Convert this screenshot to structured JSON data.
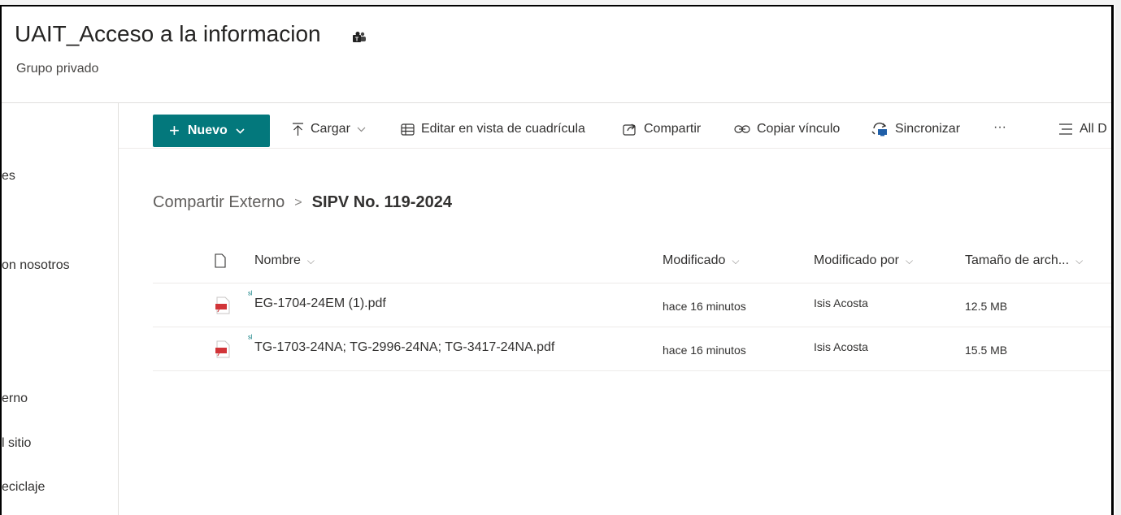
{
  "site": {
    "title": "UAIT_Acceso a la informacion",
    "subtitle": "Grupo privado",
    "teams_icon": "teams-icon"
  },
  "left_nav": {
    "items": [
      {
        "label": "es"
      },
      {
        "label": "on nosotros"
      },
      {
        "label": "erno"
      },
      {
        "label": "l sitio"
      },
      {
        "label": "eciclaje"
      }
    ]
  },
  "commandbar": {
    "new_label": "Nuevo",
    "upload_label": "Cargar",
    "grid_label": "Editar en vista de cuadrícula",
    "share_label": "Compartir",
    "copylink_label": "Copiar vínculo",
    "sync_label": "Sincronizar",
    "more_label": "···",
    "view_label": "All D",
    "accent": "#03787c"
  },
  "breadcrumb": {
    "parent": "Compartir Externo",
    "separator": ">",
    "current": "SIPV No. 119-2024"
  },
  "table": {
    "columns": {
      "name": "Nombre",
      "modified": "Modificado",
      "modified_by": "Modificado por",
      "size": "Tamaño de arch..."
    },
    "rows": [
      {
        "name": "EG-1704-24EM (1).pdf",
        "modified": "hace 16 minutos",
        "modified_by": "Isis Acosta",
        "size": "12.5 MB",
        "icon": "pdf-icon"
      },
      {
        "name": "TG-1703-24NA; TG-2996-24NA; TG-3417-24NA.pdf",
        "modified": "hace 16 minutos",
        "modified_by": "Isis Acosta",
        "size": "15.5 MB",
        "icon": "pdf-icon"
      }
    ]
  }
}
